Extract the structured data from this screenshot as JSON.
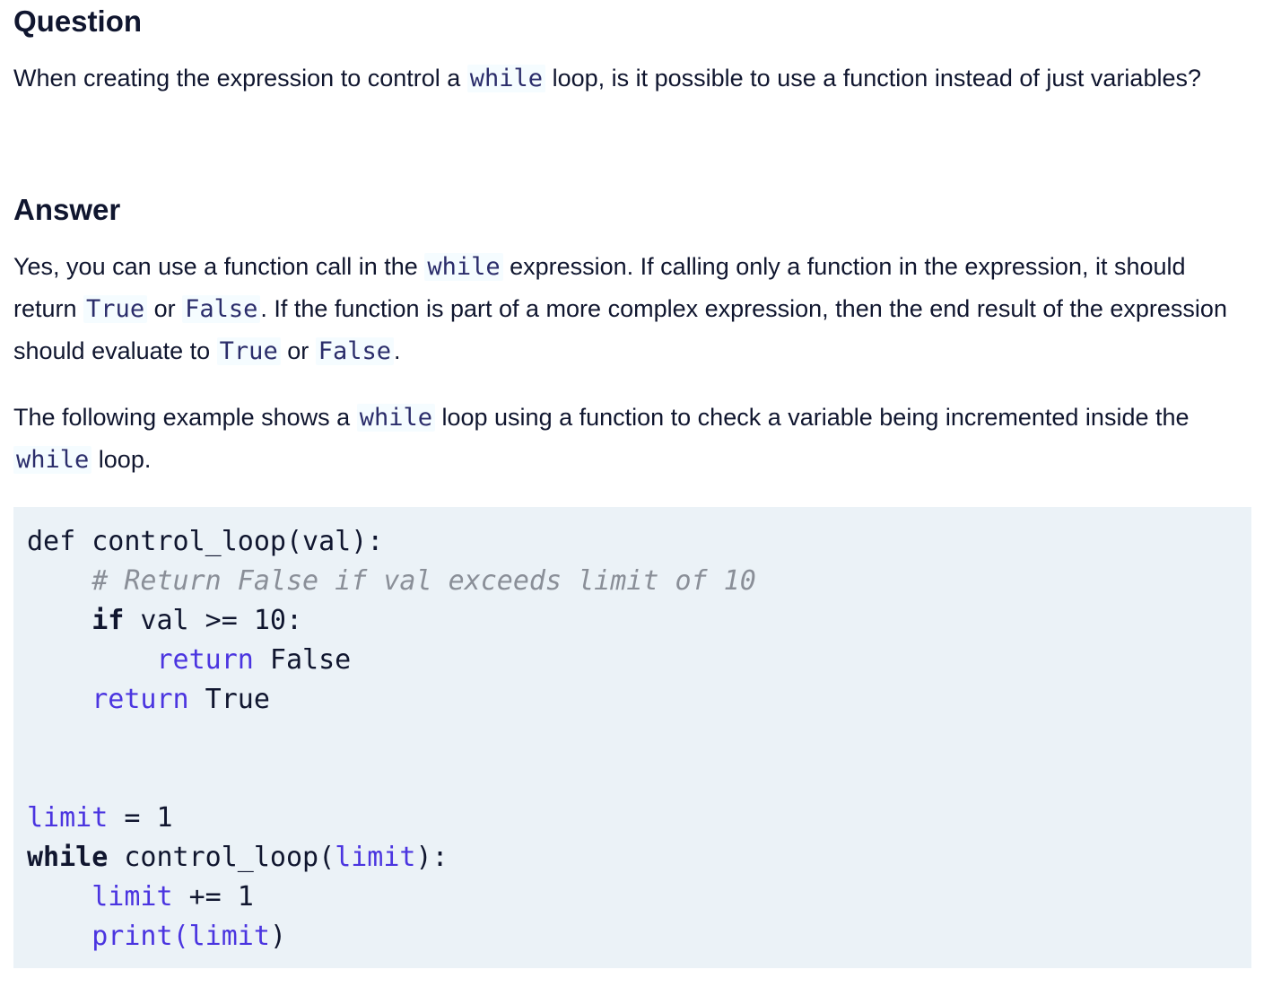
{
  "question": {
    "heading": "Question",
    "text_1": "When creating the expression to control a ",
    "code_1": "while",
    "text_2": " loop, is it possible to use a function instead of just variables?"
  },
  "answer": {
    "heading": "Answer",
    "p1": {
      "t1": "Yes, you can use a function call in the ",
      "c1": "while",
      "t2": " expression. If calling only a function in the expression, it should return ",
      "c2": "True",
      "t3": " or ",
      "c3": "False",
      "t4": ". If the function is part of a more complex expression, then the end result of the expression should evaluate to ",
      "c4": "True",
      "t5": " or ",
      "c5": "False",
      "t6": "."
    },
    "p2": {
      "t1": "The following example shows a ",
      "c1": "while",
      "t2": " loop using a function to check a variable being incremented inside the ",
      "c2": "while",
      "t3": " loop."
    }
  },
  "code": {
    "l1": {
      "kw": "def",
      "rest": " control_loop(val):"
    },
    "l2": {
      "indent": "    ",
      "comment": "# Return False if val exceeds limit of 10"
    },
    "l3": {
      "indent": "    ",
      "kw": "if",
      "rest": " val >= 10:"
    },
    "l4": {
      "indent": "        ",
      "kw": "return",
      "rest": " False"
    },
    "l5": {
      "indent": "    ",
      "kw": "return",
      "rest": " True"
    },
    "l8": {
      "var": "limit",
      "rest": " = 1"
    },
    "l9": {
      "kw": "while",
      "mid": " control_loop(",
      "var": "limit",
      "end": "):"
    },
    "l10": {
      "indent": "    ",
      "var": "limit",
      "rest": " += 1"
    },
    "l11": {
      "indent": "    ",
      "fn": "print",
      "open": "(",
      "var": "limit",
      "close": ")"
    }
  }
}
